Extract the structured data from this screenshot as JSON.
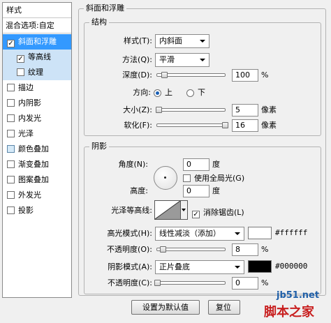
{
  "sidebar": {
    "header": "样式",
    "blending_options": "混合选项:自定",
    "items": [
      {
        "label": "斜面和浮雕",
        "checked": true
      },
      {
        "label": "等高线",
        "checked": true
      },
      {
        "label": "纹理",
        "checked": false
      },
      {
        "label": "描边",
        "checked": false
      },
      {
        "label": "内阴影",
        "checked": false
      },
      {
        "label": "内发光",
        "checked": false
      },
      {
        "label": "光泽",
        "checked": false
      },
      {
        "label": "颜色叠加",
        "checked": false
      },
      {
        "label": "渐变叠加",
        "checked": false
      },
      {
        "label": "图案叠加",
        "checked": false
      },
      {
        "label": "外发光",
        "checked": false
      },
      {
        "label": "投影",
        "checked": false
      }
    ]
  },
  "bevel": {
    "title": "斜面和浮雕",
    "structure": {
      "title": "结构",
      "style_label": "样式(T):",
      "style_value": "内斜面",
      "technique_label": "方法(Q):",
      "technique_value": "平滑",
      "depth_label": "深度(D):",
      "depth_value": "100",
      "depth_unit": "%",
      "depth_slider_fraction": 0.1,
      "direction_label": "方向:",
      "direction_up": "上",
      "direction_down": "下",
      "direction_selected": "up",
      "size_label": "大小(Z):",
      "size_value": "5",
      "size_unit": "像素",
      "size_slider_fraction": 0.02,
      "soften_label": "软化(F):",
      "soften_value": "16",
      "soften_unit": "像素",
      "soften_slider_fraction": 1.0
    },
    "shading": {
      "title": "阴影",
      "angle_label": "角度(N):",
      "angle_value": "0",
      "angle_unit": "度",
      "global_light_label": "使用全局光(G)",
      "global_light_checked": false,
      "altitude_label": "高度:",
      "altitude_value": "0",
      "altitude_unit": "度",
      "gloss_contour_label": "光泽等高线:",
      "anti_aliased_label": "消除锯齿(L)",
      "anti_aliased_checked": true,
      "highlight_mode_label": "高光模式(H):",
      "highlight_mode_value": "线性减淡（添加）",
      "highlight_color": "#ffffff",
      "highlight_color_text": "#ffffff",
      "highlight_opacity_label": "不透明度(O):",
      "highlight_opacity_value": "8",
      "highlight_opacity_unit": "%",
      "highlight_opacity_fraction": 0.08,
      "shadow_mode_label": "阴影模式(A):",
      "shadow_mode_value": "正片叠底",
      "shadow_color": "#000000",
      "shadow_color_text": "#000000",
      "shadow_opacity_label": "不透明度(C):",
      "shadow_opacity_value": "0",
      "shadow_opacity_unit": "%",
      "shadow_opacity_fraction": 0.0
    },
    "buttons": {
      "make_default": "设置为默认值",
      "reset_default": "复位"
    }
  },
  "watermark": {
    "site": "jb51.net",
    "brand": "脚本之家"
  }
}
